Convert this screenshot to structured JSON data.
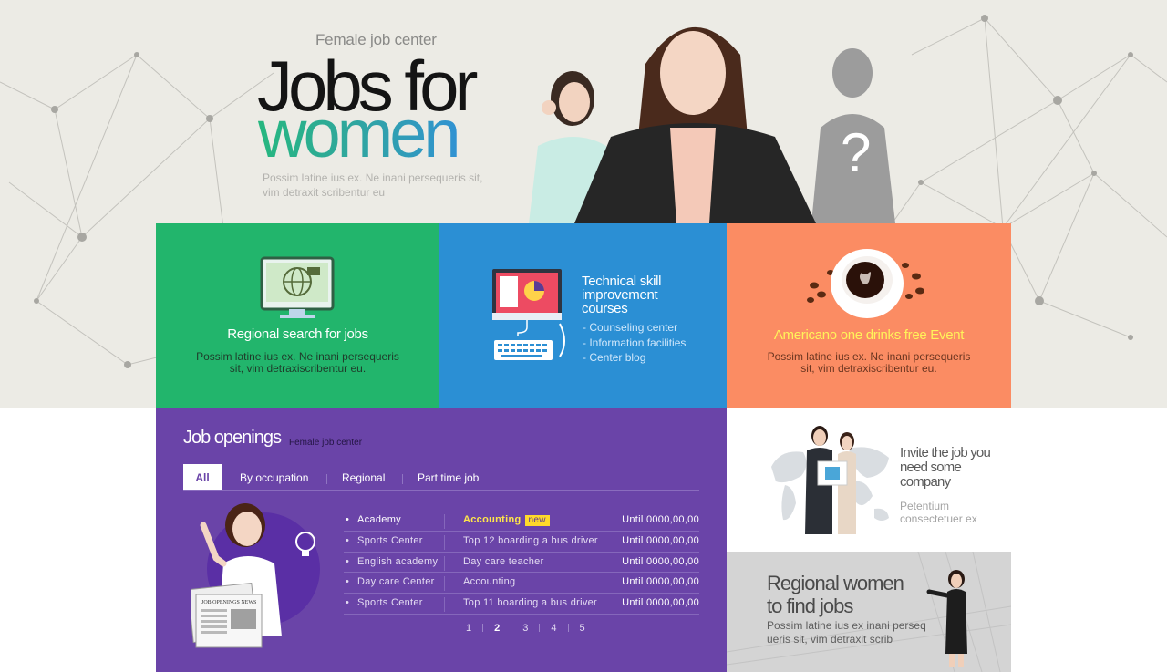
{
  "hero": {
    "subtitle": "Female job center",
    "title_line1": "Jobs for",
    "title_line2": "women",
    "description": "Possim latine ius ex. Ne inani persequeris sit, vim detraxit scribentur eu"
  },
  "features": [
    {
      "title": "Regional search for jobs",
      "description": "Possim latine ius ex. Ne inani persequeris sit, vim detraxiscribentur eu.",
      "icon": "monitor-globe-icon",
      "color": "#22b56c"
    },
    {
      "title": "Technical skill improvement courses",
      "links": [
        "Counseling center",
        "Information facilities",
        "Center blog"
      ],
      "icon": "computer-chart-icon",
      "color": "#2b8fd4"
    },
    {
      "title": "Americano one drinks free Event",
      "description": "Possim latine ius ex. Ne inani persequeris sit, vim detraxiscribentur eu.",
      "icon": "coffee-cup-icon",
      "color": "#fb8c63"
    }
  ],
  "jobs": {
    "title": "Job openings",
    "subtitle": "Female job center",
    "tabs": [
      "All",
      "By occupation",
      "Regional",
      "Part time job"
    ],
    "active_tab": "All",
    "rows": [
      {
        "category": "Academy",
        "title": "Accounting",
        "badge": "new",
        "date": "Until 0000,00,00"
      },
      {
        "category": "Sports Center",
        "title": "Top 12 boarding a bus driver",
        "date": "Until 0000,00,00"
      },
      {
        "category": "English academy",
        "title": "Day care teacher",
        "date": "Until 0000,00,00"
      },
      {
        "category": "Day care Center",
        "title": "Accounting",
        "date": "Until 0000,00,00"
      },
      {
        "category": "Sports Center",
        "title": "Top 11 boarding a bus driver",
        "date": "Until 0000,00,00"
      }
    ],
    "pages": [
      "1",
      "2",
      "3",
      "4",
      "5"
    ],
    "current_page": "2",
    "newspaper_text": "JOB OPENINGS NEWS",
    "color": "#6a44a8"
  },
  "invite": {
    "title": "Invite the job you need some company",
    "description": "Petentium consectetuer ex"
  },
  "regional": {
    "title": "Regional women to find jobs",
    "description": "Possim latine ius ex inani perseq ueris sit, vim detraxit scrib"
  }
}
